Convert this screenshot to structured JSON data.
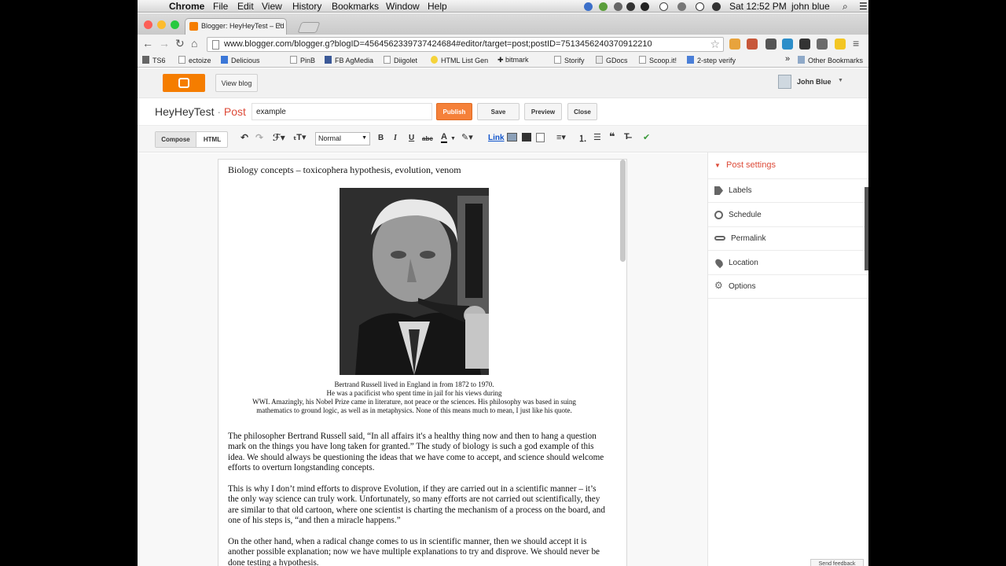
{
  "menubar": {
    "app": "Chrome",
    "items": [
      "File",
      "Edit",
      "View",
      "History",
      "Bookmarks",
      "Window",
      "Help"
    ],
    "clock": "Sat 12:52 PM",
    "user": "john blue"
  },
  "browser": {
    "tab_title": "Blogger: HeyHeyTest – Ed",
    "url": "www.blogger.com/blogger.g?blogID=4564562339737424684#editor/target=post;postID=7513456240370912210"
  },
  "bookmarks": [
    "TS6",
    "ectoize",
    "Delicious",
    "PinB",
    "FB AgMedia",
    "Diigolet",
    "HTML List Gen",
    "✚ bitmark",
    "Storify",
    "GDocs",
    "Scoop.it!",
    "2-step verify"
  ],
  "bookmarks_more": "»",
  "other_bookmarks": "Other Bookmarks",
  "blogger": {
    "view_blog": "View blog",
    "user_name": "John Blue"
  },
  "post": {
    "blog_name": "HeyHeyTest",
    "separator": " · ",
    "section": "Post",
    "title_value": "example",
    "publish": "Publish",
    "save": "Save",
    "preview": "Preview",
    "close": "Close"
  },
  "editor_toolbar": {
    "compose": "Compose",
    "html": "HTML",
    "format": "Normal",
    "bold": "B",
    "italic": "I",
    "underline": "U",
    "strike": "abc",
    "link": "Link"
  },
  "document": {
    "heading": "Biology concepts – toxicophera hypothesis, evolution, venom",
    "caption": [
      "Bertrand Russell lived in England in from 1872 to 1970.",
      "He was a pacificist who spent time in jail for his views during",
      "WWI. Amazingly, his Nobel Prize came in literature, not peace or the sciences. His philosophy was based in suing",
      "mathematics to ground logic, as well as in metaphysics. None of this means much to mean, I just like his quote."
    ],
    "paragraphs": [
      "The philosopher Bertrand Russell said, “In all affairs it's a healthy thing now and then to hang a question mark on the things you have long taken for granted.” The study of biology is such a god example of this idea. We should always be questioning the ideas that we have come to accept, and science should welcome efforts to overturn longstanding concepts.",
      "This is why I don’t mind efforts to disprove Evolution, if they are carried out in a scientific manner – it’s the only way science can truly work. Unfortunately, so many efforts are not carried out scientifically, they are similar to that old cartoon, where one scientist is charting the mechanism of a process on the board, and one of his steps is, “and then a miracle happens.”",
      "On the other hand, when a radical change comes to us in scientific manner, then we should accept it is another possible explanation; now we have multiple explanations to try and disprove. We should never be done testing a hypothesis."
    ]
  },
  "sidebar": {
    "header": "Post settings",
    "items": [
      "Labels",
      "Schedule",
      "Permalink",
      "Location",
      "Options"
    ]
  },
  "feedback": "Send feedback",
  "colors": {
    "blogger_orange": "#f57d00",
    "accent_red": "#dd4b39",
    "publish": "#f5813a"
  }
}
